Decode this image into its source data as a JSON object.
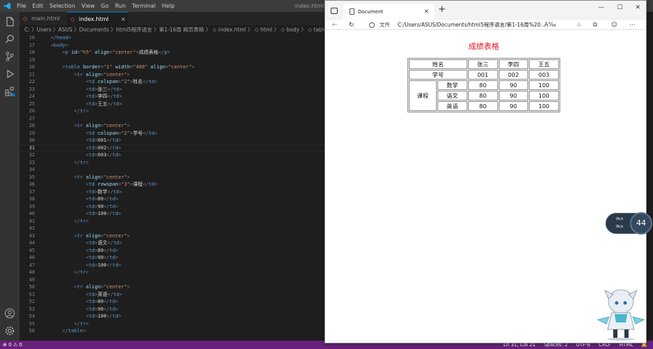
{
  "vscode": {
    "menu": [
      "File",
      "Edit",
      "Selection",
      "View",
      "Go",
      "Run",
      "Terminal",
      "Help"
    ],
    "window_title": "index.html - V",
    "tabs": [
      {
        "label": "main.html",
        "active": false
      },
      {
        "label": "index.html",
        "active": true
      }
    ],
    "tab_close": "×",
    "breadcrumb": "C: 〉Users 〉ASUS 〉Documents 〉html5程序语言 〉第1-16周 网页表格 〉 ◇ index.html 〉 ◇ html 〉 ◇ body 〉 ◇ table 〉 ◇ tr 〉 ◇",
    "line_numbers": [
      "16",
      "17",
      "18",
      "19",
      "20",
      "21",
      "22",
      "23",
      "24",
      "25",
      "26",
      "27",
      "28",
      "29",
      "30",
      "31",
      "32",
      "33",
      "34",
      "35",
      "36",
      "37",
      "38",
      "39",
      "40",
      "41",
      "42",
      "43",
      "44",
      "45",
      "46",
      "47",
      "48",
      "49",
      "50",
      "51",
      "52",
      "53",
      "54",
      "55",
      "56"
    ],
    "current_line": "31",
    "code_lines": [
      "  </head>",
      "  <body>",
      "      <p id=\"h5\" align=\"center\">成绩表格</p>",
      "",
      "      <table border=\"1\" width=\"400\" align=\"center\">",
      "          <tr align=\"center\">",
      "              <td colspan=\"2\">姓名</td>",
      "              <td>张三</td>",
      "              <td>李四</td>",
      "              <td>王五</td>",
      "          </tr>",
      "",
      "          <tr align=\"center\">",
      "              <td colspan=\"2\">学号</td>",
      "              <td>001</td>",
      "              <td>002</td>",
      "              <td>003</td>",
      "          </tr>",
      "",
      "          <tr align=\"center\">",
      "              <td rowspan=\"3\">课程</td>",
      "              <td>数学</td>",
      "              <td>80</td>",
      "              <td>90</td>",
      "              <td>100</td>",
      "          </tr>",
      "",
      "          <tr align=\"center\">",
      "              <td>语文</td>",
      "              <td>80</td>",
      "              <td>90</td>",
      "              <td>100</td>",
      "          </tr>",
      "",
      "          <tr align=\"center\">",
      "              <td>英语</td>",
      "              <td>80</td>",
      "              <td>90</td>",
      "              <td>100</td>",
      "          </tr>",
      "      </table>"
    ],
    "status_left": "⊗ 0 ⚠ 0",
    "status_right": [
      "Ln 31, Col 21",
      "Spaces: 2",
      "UTF-8",
      "CRLF",
      "HTML",
      "🔔"
    ]
  },
  "browser": {
    "tab_title": "Document",
    "tab_close": "×",
    "new_tab": "+",
    "window_controls": [
      "—",
      "☐",
      "✕"
    ],
    "address_label": "文件",
    "url": "C:/Users/ASUS/Documents/html5程序语言/第1-16周%20...",
    "toolbar_icons": [
      "A‰",
      "☆",
      "⧉",
      "☺",
      "⋯"
    ],
    "page": {
      "heading": "成绩表格",
      "table": {
        "header": [
          "姓名",
          "张三",
          "李四",
          "王五"
        ],
        "id_row": [
          "学号",
          "001",
          "002",
          "003"
        ],
        "course_label": "课程",
        "courses": [
          {
            "name": "数学",
            "scores": [
              "80",
              "90",
              "100"
            ]
          },
          {
            "name": "语文",
            "scores": [
              "80",
              "90",
              "100"
            ]
          },
          {
            "name": "英语",
            "scores": [
              "80",
              "90",
              "100"
            ]
          }
        ]
      }
    }
  },
  "widget": {
    "line1": "0k/s",
    "line2": "0k/s",
    "percent": "44"
  },
  "colors": {
    "vs_status": "#68217a",
    "heading_red": "#e81123",
    "vs_accent": "#007acc"
  }
}
